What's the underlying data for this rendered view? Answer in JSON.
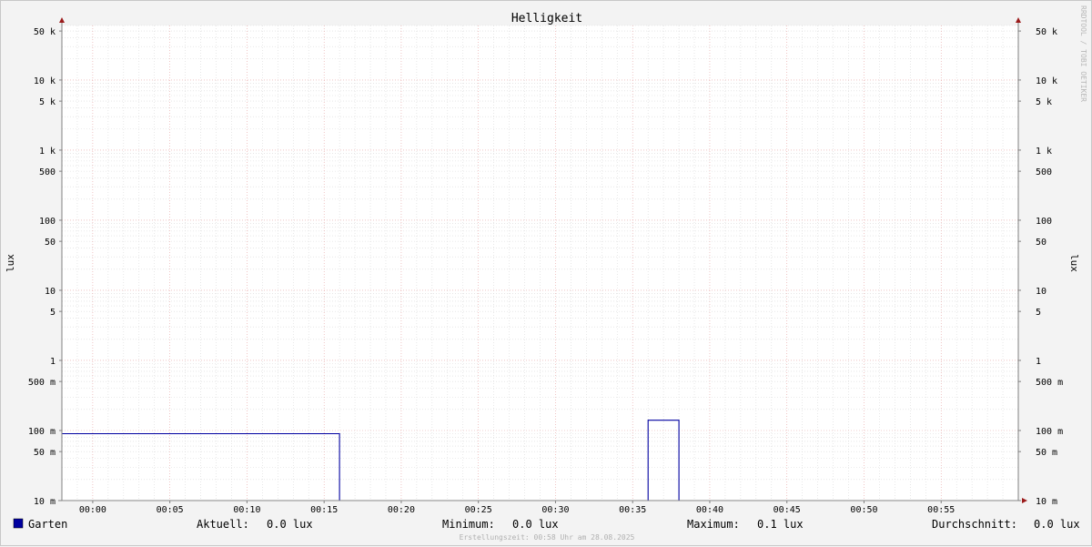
{
  "chart_data": {
    "type": "line",
    "title": "Helligkeit",
    "ylabel": "lux",
    "y_scale": "log",
    "ylim": [
      0.01,
      60000
    ],
    "x_range": [
      "23:58",
      "01:00"
    ],
    "x_tick_labels": [
      "00:00",
      "00:05",
      "00:10",
      "00:15",
      "00:20",
      "00:25",
      "00:30",
      "00:35",
      "00:40",
      "00:45",
      "00:50",
      "00:55"
    ],
    "y_tick_labels": [
      {
        "value": 50000,
        "label": "50 k"
      },
      {
        "value": 10000,
        "label": "10 k"
      },
      {
        "value": 5000,
        "label": "5 k"
      },
      {
        "value": 1000,
        "label": "1 k"
      },
      {
        "value": 500,
        "label": "500"
      },
      {
        "value": 100,
        "label": "100"
      },
      {
        "value": 50,
        "label": "50"
      },
      {
        "value": 10,
        "label": "10"
      },
      {
        "value": 5,
        "label": "5"
      },
      {
        "value": 1,
        "label": "1"
      },
      {
        "value": 0.5,
        "label": "500 m"
      },
      {
        "value": 0.1,
        "label": "100 m"
      },
      {
        "value": 0.05,
        "label": "50 m"
      },
      {
        "value": 0.01,
        "label": "10 m"
      }
    ],
    "grid": true,
    "series": [
      {
        "name": "Garten",
        "color": "#0000a0",
        "points": [
          {
            "x": "23:58",
            "y": 0.09
          },
          {
            "x": "00:16",
            "y": 0.09
          },
          {
            "x": "00:16",
            "y": 0.01
          },
          {
            "x": "00:36",
            "y": 0.01
          },
          {
            "x": "00:36",
            "y": 0.14
          },
          {
            "x": "00:38",
            "y": 0.14
          },
          {
            "x": "00:38",
            "y": 0.01
          },
          {
            "x": "01:00",
            "y": 0.01
          }
        ]
      }
    ]
  },
  "legend": {
    "series_name": "Garten",
    "swatch_color": "#0000a0",
    "current_label": "Aktuell:",
    "current_value": "0.0 lux",
    "min_label": "Minimum:",
    "min_value": "0.0 lux",
    "max_label": "Maximum:",
    "max_value": "0.1 lux",
    "avg_label": "Durchschnitt:",
    "avg_value": "0.0 lux"
  },
  "credit": "RRDTOOL / TOBI OETIKER",
  "footer": "Erstellungszeit: 00:58 Uhr am 28.08.2025"
}
